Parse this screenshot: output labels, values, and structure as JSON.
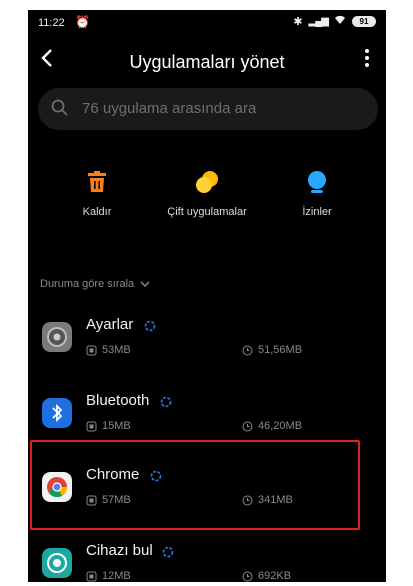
{
  "status_bar": {
    "time": "11:22",
    "battery": "91"
  },
  "header": {
    "title": "Uygulamaları yönet"
  },
  "search": {
    "placeholder": "76 uygulama arasında ara"
  },
  "actions": [
    {
      "label": "Kaldır",
      "icon": "trash-icon",
      "color": "#ff7a1a"
    },
    {
      "label": "Çift uygulamalar",
      "icon": "dual-apps-icon",
      "color": "#ffb800"
    },
    {
      "label": "İzinler",
      "icon": "permissions-icon",
      "color": "#2aa8ff"
    }
  ],
  "sort": {
    "label": "Duruma göre sırala"
  },
  "apps": [
    {
      "name": "Ayarlar",
      "storage": "53MB",
      "data": "51,56MB",
      "icon": "settings-app-icon"
    },
    {
      "name": "Bluetooth",
      "storage": "15MB",
      "data": "46,20MB",
      "icon": "bluetooth-app-icon"
    },
    {
      "name": "Chrome",
      "storage": "57MB",
      "data": "341MB",
      "icon": "chrome-app-icon",
      "highlighted": true
    },
    {
      "name": "Cihazı bul",
      "storage": "12MB",
      "data": "692KB",
      "icon": "find-device-app-icon"
    }
  ],
  "colors": {
    "highlight": "#e02020",
    "background": "#000000"
  }
}
